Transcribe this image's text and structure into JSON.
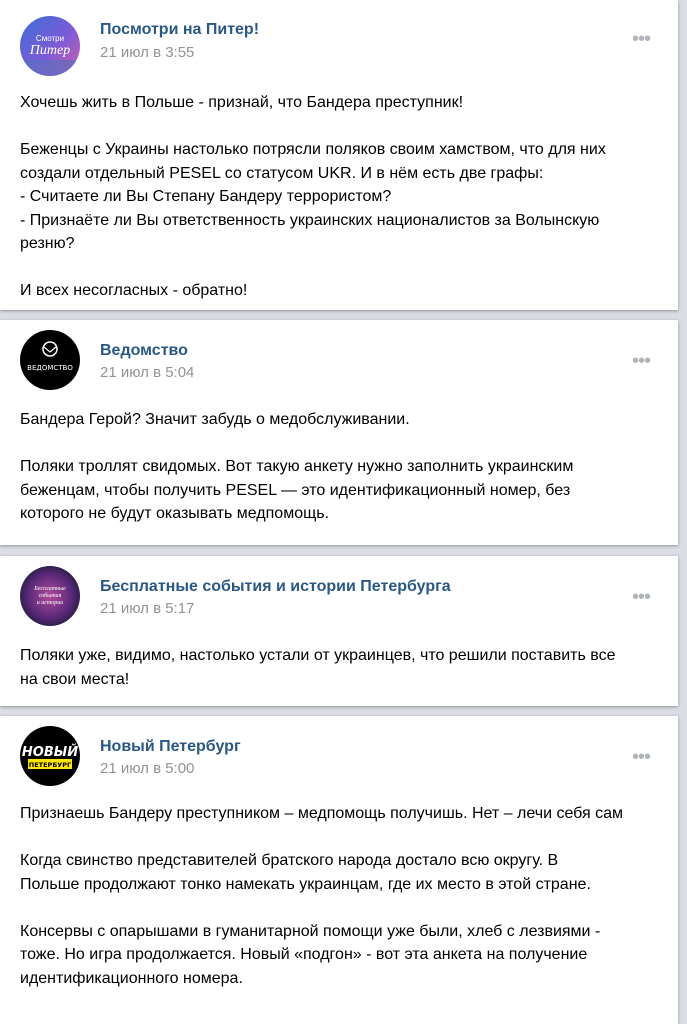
{
  "posts": [
    {
      "author": "Посмотри на Питер!",
      "date": "21 июл в 3:55",
      "avatar_text": "Смотри Питер",
      "paragraphs": [
        "Хочешь жить в Польше - признай, что Бандера преступник!",
        "Беженцы с Украины настолько потрясли поляков своим хамством, что для них\nсоздали отдельный PESEL со статусом UKR. И в нём есть две графы:\n- Считаете ли Вы Степану Бандеру террористом?\n- Признаёте ли Вы ответственность украинских националистов за Волынскую\nрезню?",
        "И всех несогласных - обратно!"
      ]
    },
    {
      "author": "Ведомство",
      "date": "21 июл в 5:04",
      "avatar_text": "ВЕДОМСТВО",
      "paragraphs": [
        "Бандера Герой? Значит забудь о медобслуживании.",
        "Поляки троллят свидомых. Вот такую анкету нужно заполнить украинским\nбеженцам, чтобы получить PESEL — это идентификационный номер, без\nкоторого не будут оказывать медпомощь."
      ]
    },
    {
      "author": "Бесплатные события и истории Петербурга",
      "date": "21 июл в 5:17",
      "avatar_text": "Бесплатные события и истории",
      "paragraphs": [
        "Поляки уже, видимо, настолько устали от украинцев, что решили поставить все\nна свои места!"
      ]
    },
    {
      "author": "Новый Петербург",
      "date": "21 июл в 5:00",
      "avatar_text_top": "НОВЫЙ",
      "avatar_text_bottom": "ПЕТЕРБУРГ",
      "paragraphs": [
        "Признаешь Бандеру преступником – медпомощь получишь. Нет – лечи себя сам",
        "Когда свинство представителей братского народа достало всю округу. В\nПольше продолжают тонко намекать украинцам, где их место в этой стране.",
        "Консервы с опарышами в гуманитарной помощи уже были, хлеб с лезвиями -\nтоже. Но игра продолжается. Новый «подгон» - вот эта анкета на получение\nидентификационного номера."
      ]
    }
  ],
  "more_icon": "•••",
  "colors": {
    "author": "#2a5885",
    "date": "#939393",
    "background": "#dadde3"
  }
}
